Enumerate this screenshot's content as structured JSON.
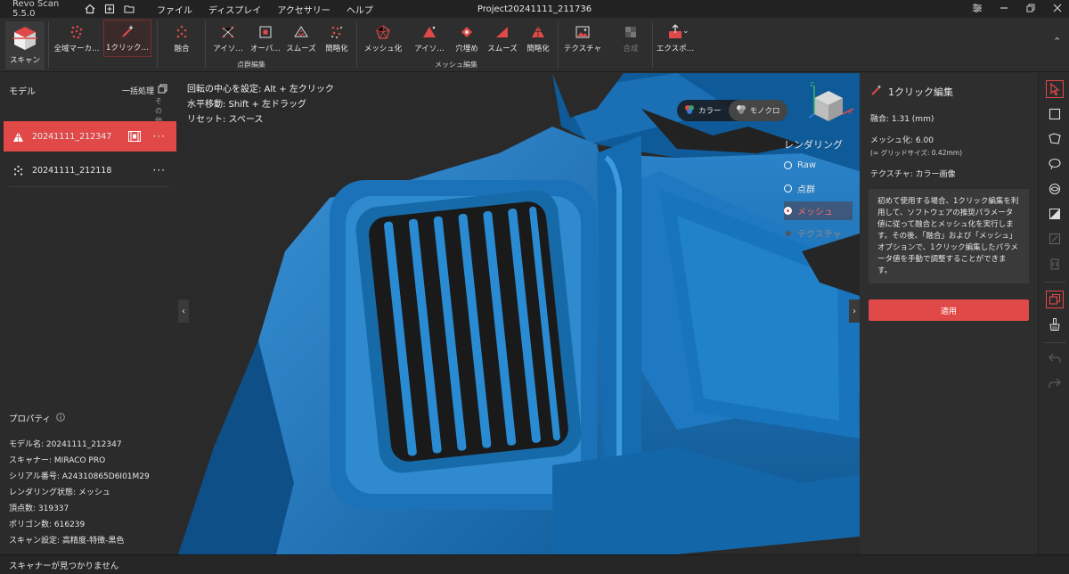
{
  "titlebar": {
    "app_name": "Revo Scan 5.5.0",
    "menu": [
      "ファイル",
      "ディスプレイ",
      "アクセサリー",
      "ヘルプ"
    ],
    "project": "Project20241111_211736"
  },
  "toolbar": {
    "scan": "スキャン",
    "tools": [
      "全域マーカ…",
      "1クリック…",
      "融合",
      "アイソ…",
      "オーバ…",
      "スムーズ",
      "簡略化",
      "メッシュ化",
      "アイソ…",
      "穴埋め",
      "スムーズ",
      "簡略化",
      "テクスチャ",
      "合成",
      "エクスポ…"
    ],
    "groups": {
      "point_cloud": "点群編集",
      "mesh": "メッシュ編集"
    },
    "accent": "#e14848"
  },
  "left": {
    "title": "モデル",
    "batch": "一括処理",
    "other": "その他",
    "models": [
      {
        "name": "20241111_212347"
      },
      {
        "name": "20241111_212118"
      }
    ],
    "props_title": "プロパティ",
    "props": [
      "モデル名: 20241111_212347",
      "スキャナー: MIRACO PRO",
      "シリアル番号: A24310865D6I01M29",
      "レンダリング状態: メッシュ",
      "頂点数: 319337",
      "ポリゴン数: 616239",
      "スキャン設定: 高精度-特徴-黒色"
    ]
  },
  "viewport": {
    "hints": [
      "回転の中心を設定: Alt + 左クリック",
      "水平移動: Shift + 左ドラッグ",
      "リセット: スペース"
    ],
    "color_mode": [
      "カラー",
      "モノクロ"
    ],
    "render_title": "レンダリング",
    "render_opts": [
      "Raw",
      "点群",
      "メッシュ",
      "テクスチャ"
    ],
    "mesh_color": "#1e78c2"
  },
  "right": {
    "title": "1クリック編集",
    "fusion": "融合:  1.31 (mm)",
    "mesh": "メッシュ化:  6.00",
    "grid": "(≈ グリッドサイズ: 0.42mm)",
    "texture": "テクスチャ: カラー画像",
    "info": "初めて使用する場合、1クリック編集を利用して、ソフトウェアの推奨パラメータ値に従って融合とメッシュ化を実行します。その後、「融合」および「メッシュ」オプションで、1クリック編集したパラメータ値を手動で調整することができます。",
    "apply": "適用"
  },
  "status": "スキャナーが見つかりません"
}
